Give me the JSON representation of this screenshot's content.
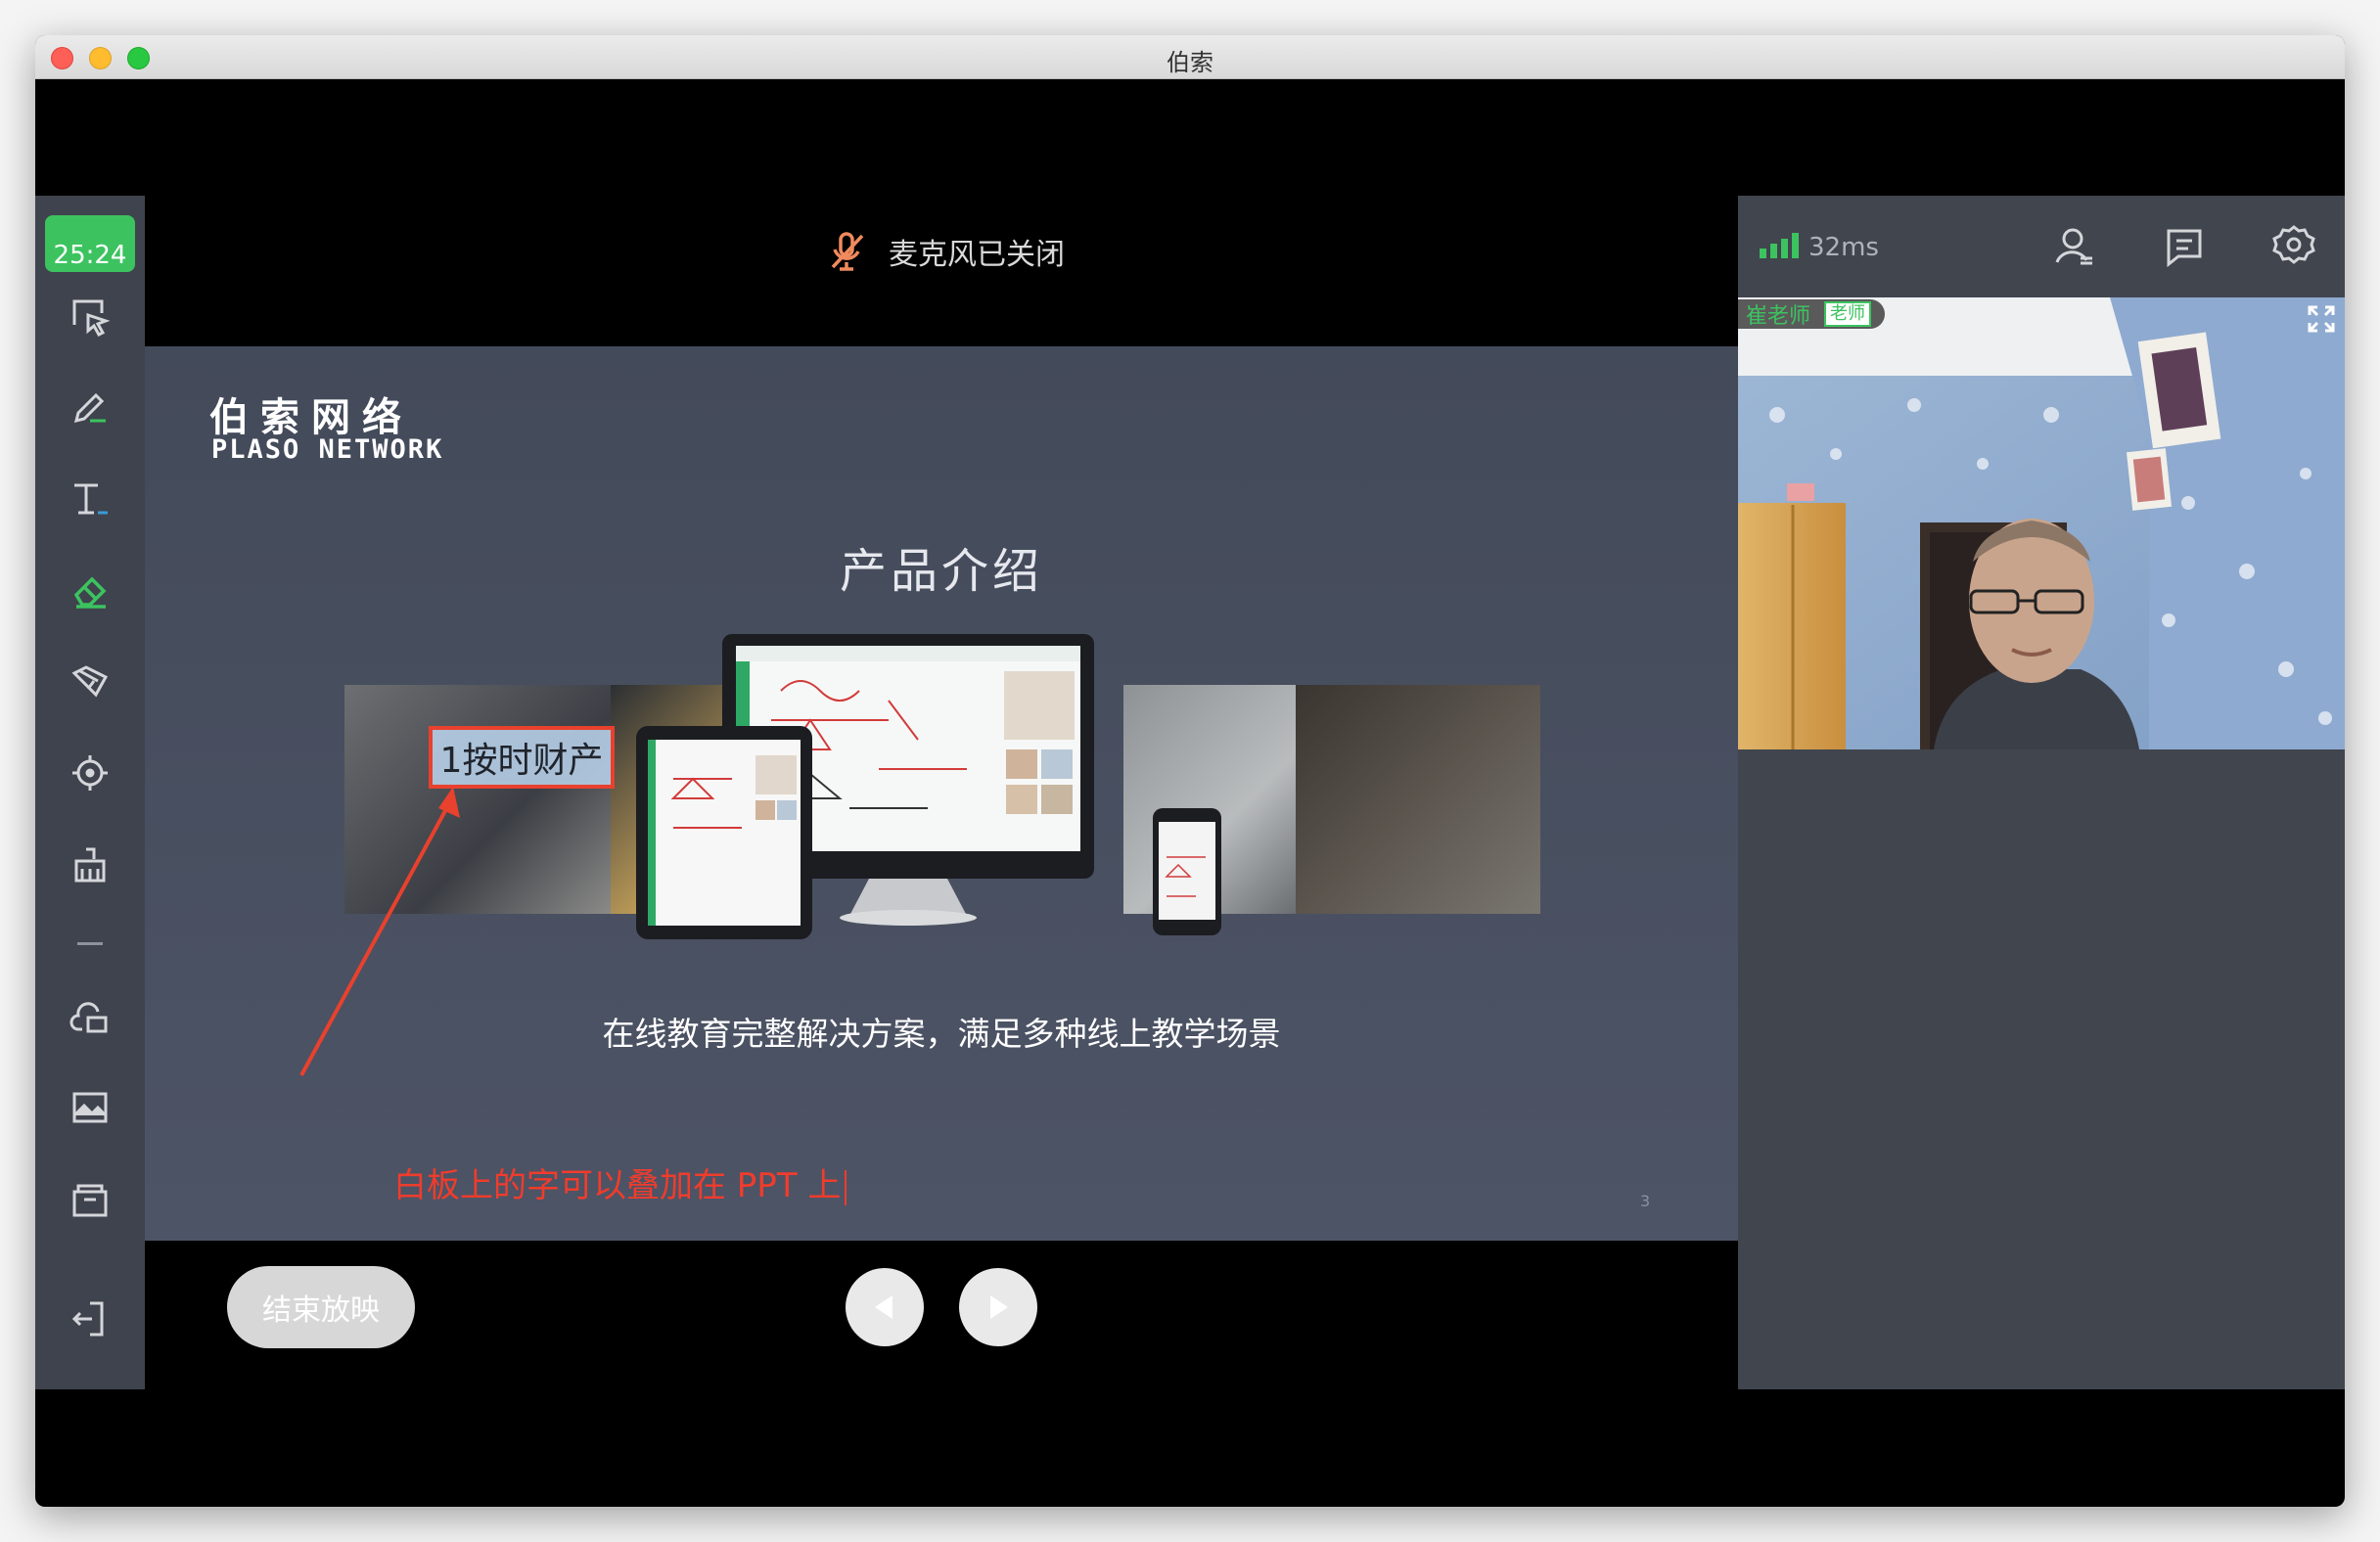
{
  "window": {
    "title": "伯索"
  },
  "toolbar": {
    "timer": "25:24",
    "tools": [
      "select-icon",
      "pen-icon",
      "text-icon",
      "eraser-icon",
      "shape-icon",
      "laser-icon",
      "clear-icon",
      "divider",
      "cloud-files-icon",
      "image-icon",
      "archive-icon",
      "exit-icon"
    ]
  },
  "stage": {
    "mic_status": "麦克风已关闭",
    "end_show_label": "结束放映"
  },
  "slide": {
    "brand_cn": "伯索网络",
    "brand_en": "PLASO NETWORK",
    "heading": "产品介绍",
    "annotation_box_text": "1按时财产",
    "subtitle": "在线教育完整解决方案，满足多种线上教学场景",
    "whiteboard_text": "白板上的字可以叠加在 PPT 上",
    "page_number": "3"
  },
  "right_panel": {
    "latency": "32ms",
    "participant_name": "崔老师",
    "participant_role": "老师"
  },
  "colors": {
    "accent_green": "#3cc35f",
    "annotation_red": "#e8412e",
    "slide_bg": "#464d5c",
    "toolbar_bg": "#3f434d"
  }
}
